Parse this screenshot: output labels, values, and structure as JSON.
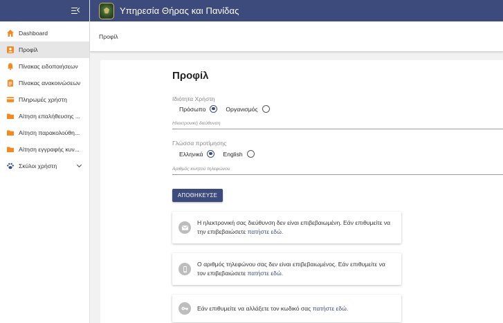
{
  "header": {
    "title": "Υπηρεσία Θήρας και Πανίδας"
  },
  "sidebar": {
    "items": [
      {
        "label": "Dashboard",
        "icon": "home-icon"
      },
      {
        "label": "Προφίλ",
        "icon": "account-icon",
        "active": true
      },
      {
        "label": "Πίνακας ειδοποιήσεων",
        "icon": "bell-icon"
      },
      {
        "label": "Πίνακας ανακοινώσεων",
        "icon": "clipboard-icon"
      },
      {
        "label": "Πληρωμές χρήστη",
        "icon": "credit-card-icon"
      },
      {
        "label": "Αίτηση επαλήθευσης ...",
        "icon": "folder-icon"
      },
      {
        "label": "Αίτηση παρακολούθη...",
        "icon": "folder-icon"
      },
      {
        "label": "Αίτηση εγγραφής κυν...",
        "icon": "folder-icon"
      },
      {
        "label": "Σκύλοι χρήστη",
        "icon": "paw-icon"
      }
    ]
  },
  "breadcrumb": {
    "current": "Προφίλ"
  },
  "profile": {
    "title": "Προφίλ",
    "ownership_label": "Ιδιότητα Χρήστη",
    "ownership_options": [
      "Πρόσωπο",
      "Οργανισμός"
    ],
    "email_placeholder": "Ηλεκτρονική διεύθυνση",
    "language_label": "Γλώσσα προτίμησης",
    "language_options": [
      "Ελληνικά",
      "English"
    ],
    "phone_placeholder": "Αριθμός κινητού τηλεφώνου",
    "save_label": "ΑΠΟΘΗΚΕΥΣΕ"
  },
  "cards": {
    "email": {
      "line1": "Η ηλεκτρονική σας διεύθυνση δεν είναι επιβεβαιωμένη. Εάν επιθυμείτε να",
      "line2": "την επιβεβαιώσετε ",
      "link": "πατήστε εδώ."
    },
    "phone": {
      "line1": "Ο αριθμός τηλεφώνου σας δεν είναι επιβεβαιωμένος. Εάν επιθυμείτε να",
      "line2": "τον επιβεβαιώσετε ",
      "link": "πατήστε εδώ."
    },
    "password": {
      "line1": "Εάν επιθυμείτε να αλλάξετε τον κωδικό σας ",
      "link": "πατήστε εδώ."
    }
  },
  "colors": {
    "primary": "#3c4b7c",
    "accent_orange": "#f08a24",
    "icon_grey": "#bdbdbd"
  }
}
